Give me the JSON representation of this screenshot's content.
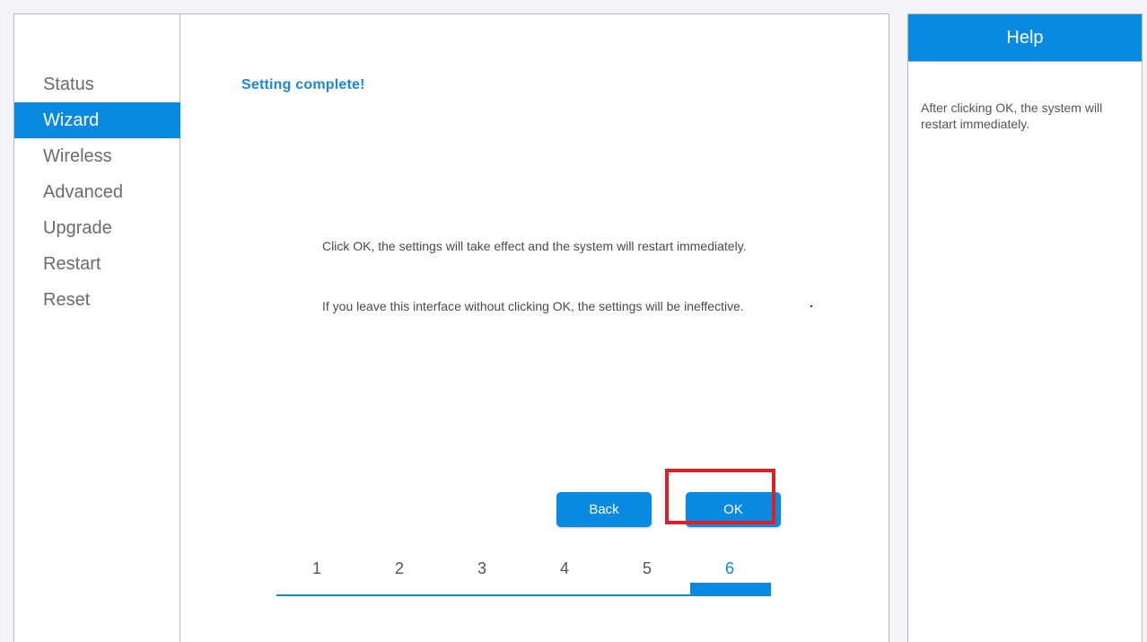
{
  "sidebar": {
    "items": [
      {
        "label": "Status",
        "active": false
      },
      {
        "label": "Wizard",
        "active": true
      },
      {
        "label": "Wireless",
        "active": false
      },
      {
        "label": "Advanced",
        "active": false
      },
      {
        "label": "Upgrade",
        "active": false
      },
      {
        "label": "Restart",
        "active": false
      },
      {
        "label": "Reset",
        "active": false
      }
    ]
  },
  "main": {
    "title": "Setting complete!",
    "message1": "Click OK, the settings will take effect and the system will restart immediately.",
    "message2": "If you leave this interface without clicking OK, the settings will be ineffective.",
    "back_label": "Back",
    "ok_label": "OK"
  },
  "steps": {
    "items": [
      "1",
      "2",
      "3",
      "4",
      "5",
      "6"
    ],
    "current": "6"
  },
  "help": {
    "title": "Help",
    "text": "After clicking OK, the system will restart immediately."
  },
  "colors": {
    "accent": "#0a89e3",
    "highlight": "#e01e26"
  }
}
